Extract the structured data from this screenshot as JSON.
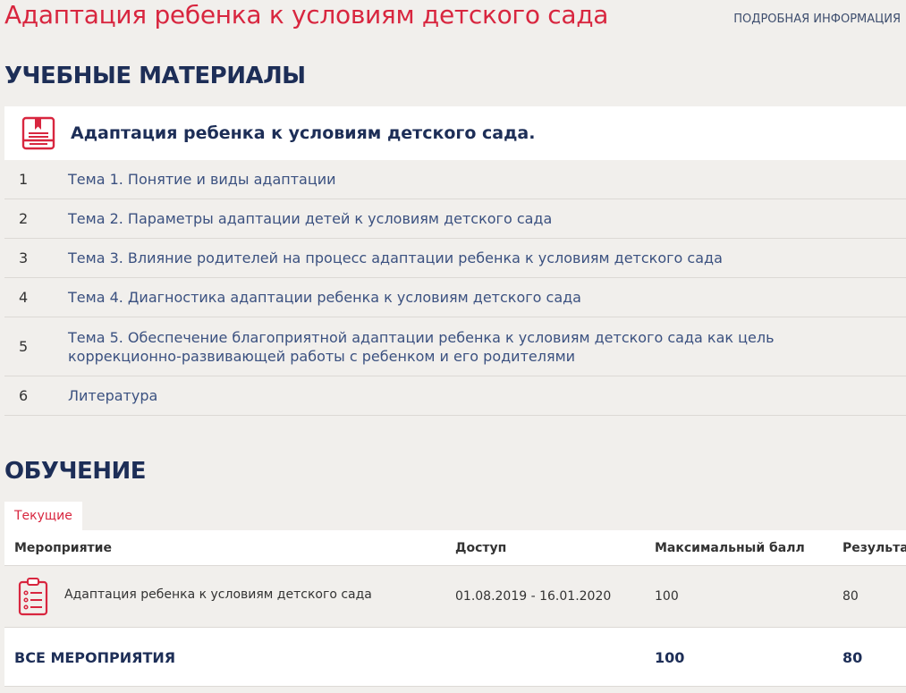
{
  "header": {
    "title": "Адаптация ребенка к условиям детского сада",
    "more_link": "ПОДРОБНАЯ ИНФОРМАЦИЯ"
  },
  "materials": {
    "heading": "УЧЕБНЫЕ МАТЕРИАЛЫ",
    "course_icon": "book-icon",
    "course_name": "Адаптация ребенка к условиям детского сада.",
    "topics": [
      {
        "num": "1",
        "label": "Тема 1. Понятие и виды адаптации"
      },
      {
        "num": "2",
        "label": "Тема 2. Параметры адаптации детей к условиям детского сада"
      },
      {
        "num": "3",
        "label": "Тема 3. Влияние родителей на процесс адаптации ребенка к условиям детского сада"
      },
      {
        "num": "4",
        "label": "Тема 4. Диагностика адаптации ребенка к условиям детского сада"
      },
      {
        "num": "5",
        "label": "Тема 5. Обеспечение благоприятной адаптации ребенка к условиям детского сада как цель коррекционно-развивающей работы с ребенком и его родителями"
      },
      {
        "num": "6",
        "label": "Литература"
      }
    ]
  },
  "training": {
    "heading": "ОБУЧЕНИЕ",
    "tab_label": "Текущие",
    "columns": [
      "Мероприятие",
      "Доступ",
      "Максимальный балл",
      "Результат"
    ],
    "rows": [
      {
        "icon": "clipboard-list-icon",
        "event": "Адаптация ребенка к условиям детского сада",
        "access": "01.08.2019 - 16.01.2020",
        "max_score": "100",
        "result": "80"
      }
    ],
    "total": {
      "label": "ВСЕ МЕРОПРИЯТИЯ",
      "max_score": "100",
      "result": "80"
    }
  },
  "colors": {
    "accent": "#d8263f",
    "heading": "#1d2e57",
    "link": "#3b5180",
    "background": "#f1efec"
  }
}
